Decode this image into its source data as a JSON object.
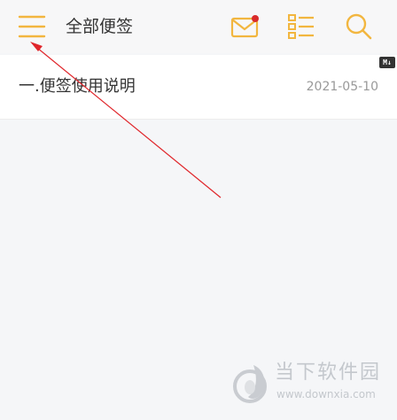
{
  "header": {
    "title": "全部便签",
    "icons": [
      "menu-icon",
      "mail-icon",
      "list-icon",
      "search-icon"
    ],
    "has_unread_mail": true
  },
  "notes": [
    {
      "title": "一.便签使用说明",
      "date": "2021-05-10",
      "badge": "M↓"
    }
  ],
  "watermark": {
    "brand": "当下软件园",
    "url": "www.downxia.com"
  },
  "colors": {
    "accent": "#f2b63f",
    "notification_dot": "#d92b2b",
    "annotation_arrow": "#e0262b",
    "background": "#f5f6f8",
    "header_background": "#f7f7f8",
    "text_primary": "#333333",
    "text_secondary": "#999999"
  }
}
